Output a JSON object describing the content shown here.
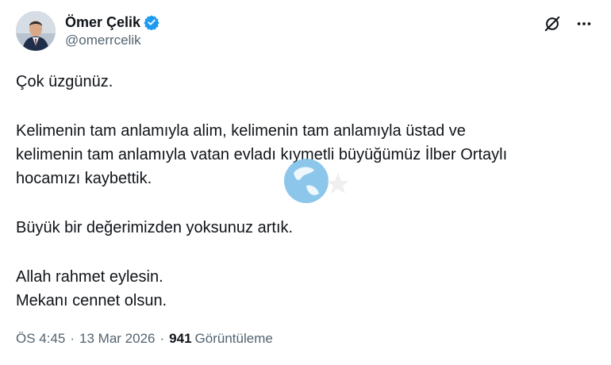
{
  "author": {
    "name": "Ömer Çelik",
    "handle": "@omerrcelik",
    "avatar_icon": "profile-photo",
    "verified_color": "#1d9bf0"
  },
  "top_icons": [
    "grok-icon",
    "more-options-icon"
  ],
  "tweet": {
    "paragraphs": [
      "Çok üzgünüz.",
      "Kelimenin tam anlamıyla alim, kelimenin tam anlamıyla üstad ve\nkelimenin tam anlamıyla vatan evladı kıymetli büyüğümüz İlber Ortaylı\nhocamızı kaybettik.",
      "Büyük bir değerimizden yoksunuz artık.",
      "Allah rahmet eylesin.\nMekanı cennet olsun."
    ]
  },
  "meta": {
    "time": "ÖS 4:45",
    "separator": "·",
    "date": "13 Mar 2026",
    "views_count": "941",
    "views_label": "Görüntüleme"
  },
  "colors": {
    "text_primary": "#0f1419",
    "text_secondary": "#536471",
    "watermark_red": "#e3363c",
    "watermark_blue": "#6fb9e6"
  }
}
